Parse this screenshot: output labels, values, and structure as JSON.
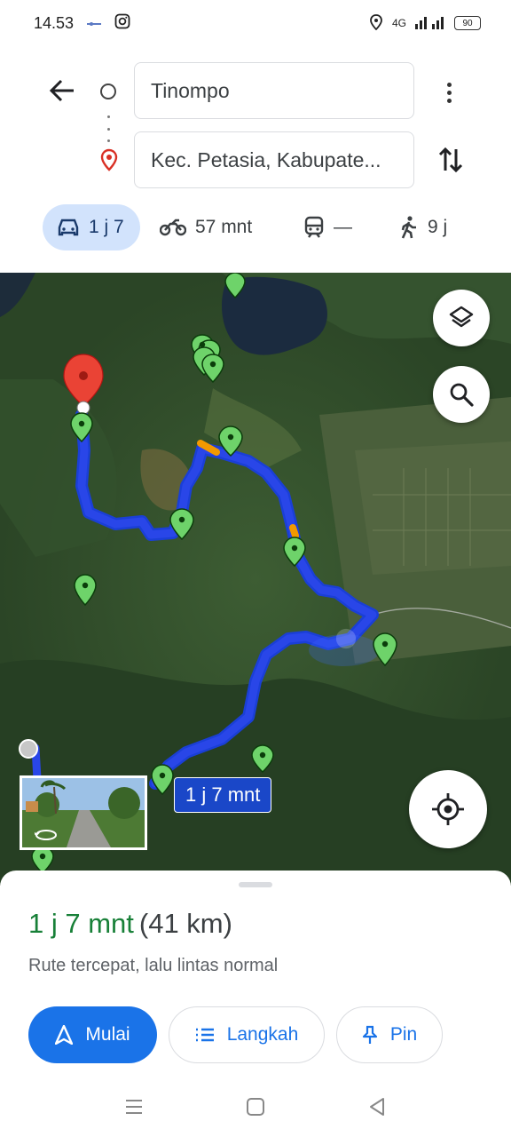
{
  "status_bar": {
    "time": "14.53",
    "network": "4G",
    "battery": "90"
  },
  "directions": {
    "origin": "Tinompo",
    "destination": "Kec. Petasia, Kabupate...",
    "modes": [
      {
        "name": "car",
        "icon": "car-icon",
        "label": "1 j 7",
        "selected": true
      },
      {
        "name": "motorcycle",
        "icon": "motorcycle-icon",
        "label": "57 mnt"
      },
      {
        "name": "transit",
        "icon": "train-icon",
        "label": "—"
      },
      {
        "name": "walk",
        "icon": "walk-icon",
        "label": "9 j"
      }
    ]
  },
  "map": {
    "route_label": "1 j 7 mnt",
    "route_color": "#2946e8",
    "pin_color": "#6ed36a",
    "destination_pin_color": "#e53935"
  },
  "sheet": {
    "duration": "1 j 7 mnt",
    "distance": "(41 km)",
    "subtitle": "Rute tercepat, lalu lintas normal",
    "buttons": {
      "start": "Mulai",
      "steps": "Langkah",
      "pin": "Pin"
    }
  },
  "colors": {
    "accent": "#1a73e8",
    "duration_green": "#188038",
    "selected_mode_bg": "#d2e3fc"
  }
}
